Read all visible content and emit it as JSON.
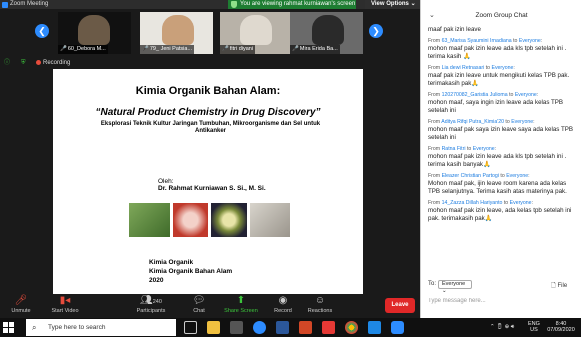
{
  "window": {
    "title": "Zoom Meeting"
  },
  "banner": {
    "text": "You are viewing rahmat kurniawan's screen",
    "view_options": "View Options"
  },
  "gallery": {
    "participants": [
      {
        "name": "60_Debora M..."
      },
      {
        "name": "79_ Jeni Patsia..."
      },
      {
        "name": "fitri diyani"
      },
      {
        "name": "Mira Erida Ba..."
      }
    ]
  },
  "status": {
    "recording": "Recording"
  },
  "slide": {
    "title": "Kimia Organik Bahan Alam:",
    "subtitle": "“Natural Product Chemistry in Drug Discovery”",
    "description": "Eksplorasi Teknik Kultur Jaringan Tumbuhan, Mikroorganisme dan Sel untuk Antikanker",
    "oleh": "Oleh:",
    "author": "Dr. Rahmat Kurniawan S. Si., M. Si.",
    "course_lines": [
      "Kimia Organik",
      "Kimia Organik Bahan Alam",
      "2020"
    ]
  },
  "toolbar": {
    "unmute": "Unmute",
    "start_video": "Start Video",
    "participants": "Participants",
    "participants_count": "240",
    "chat": "Chat",
    "share_screen": "Share Screen",
    "record": "Record",
    "reactions": "Reactions",
    "leave": "Leave"
  },
  "chat": {
    "title": "Zoom Group Chat",
    "messages": [
      {
        "from": "",
        "to": "",
        "text": "maaf pak izin leave"
      },
      {
        "from": "63_Marisa Syaumini Irnadiana",
        "to": "Everyone",
        "text": "mohon maaf pak izin leave ada kls tpb setelah ini . terima kasih 🙏"
      },
      {
        "from": "Lia dewi Retnasari",
        "to": "Everyone",
        "text": "maaf pak izin leave untuk mengikuti kelas TPB pak. terimakasih pak🙏"
      },
      {
        "from": "120270082_Garistia Julioma",
        "to": "Everyone",
        "text": "mohon maaf, saya ingin izin leave ada kelas TPB setelah ini"
      },
      {
        "from": "Aditya Rifqi Putra_Kimia'20",
        "to": "Everyone",
        "text": "mohon maaf pak saya izin leave saya ada kelas TPB setelah ini"
      },
      {
        "from": "Ratna Fitri",
        "to": "Everyone",
        "text": "mohon maaf pak izin leave ada kls tpb setelah ini . terima kasih banyak🙏"
      },
      {
        "from": "Eleazer Christian Partogi",
        "to": "Everyone",
        "text": "Mohon maaf pak, ijin leave room karena ada kelas TPB selanjutnya. Terima kasih atas materinya pak."
      },
      {
        "from": "14_Zazza Dillah Hariyanto",
        "to": "Everyone",
        "text": "mohon maaf pak izin leave, ada kelas tpb setelah ini pak. terimakasih pak🙏"
      }
    ],
    "from_prefix": "From",
    "to_word": "to",
    "to_label": "To:",
    "to_value": "Everyone",
    "file_label": "File",
    "input_placeholder": "Type message here..."
  },
  "taskbar": {
    "search_placeholder": "Type here to search",
    "lang": "ENG",
    "locale": "US",
    "time": "8:40",
    "date": "07/09/2020"
  },
  "colors": {
    "zoom_blue": "#2d8cff",
    "leave_red": "#e02828",
    "banner_green": "#1e7d32",
    "share_green": "#3cc43c"
  }
}
